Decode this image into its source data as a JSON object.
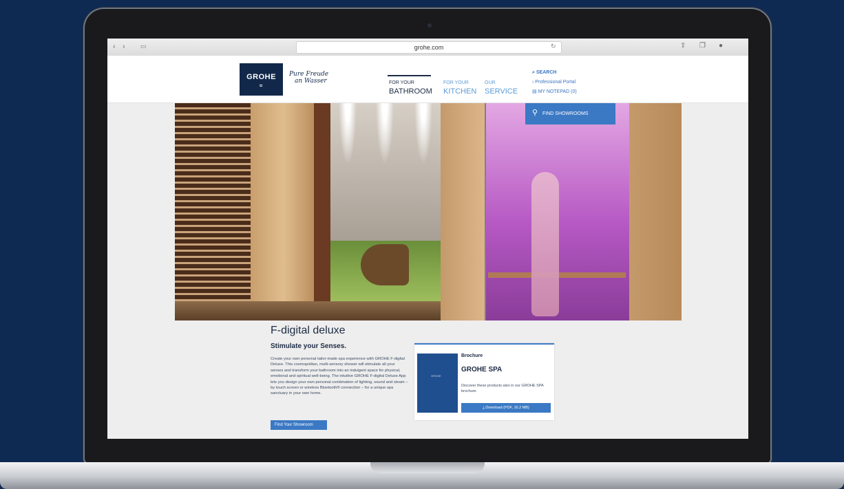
{
  "browser": {
    "url": "grohe.com",
    "icons": [
      "back-icon",
      "forward-icon",
      "sidebar-icon",
      "reload-icon",
      "share-icon",
      "tabs-icon",
      "extension-icon"
    ]
  },
  "header": {
    "logo_text": "GROHE",
    "tagline_line1": "Pure Freude",
    "tagline_line2": "an Wasser",
    "tabs": [
      {
        "small": "FOR YOUR",
        "big": "BATHROOM"
      },
      {
        "small": "FOR YOUR",
        "big": "KITCHEN"
      },
      {
        "small": "OUR",
        "big": "SERVICE"
      }
    ],
    "search": "SEARCH",
    "professional": "Professional Portal",
    "notepad": "MY NOTEPAD (0)",
    "showrooms": "FIND SHOWROOMS"
  },
  "content": {
    "title": "F-digital deluxe",
    "subtitle": "Stimulate your Senses.",
    "body": "Create your own personal tailor-made spa experience with GROHE F-digital Deluxe. This cosmopolitan, multi-sensory shower will stimulate all your senses and transform your bathroom into an indulgent space for physical, emotional and spiritual well-being. The intuitive GROHE F-digital Deluxe App lets you design your own personal combination of lighting, sound and steam – by touch screen or wireless Bluetooth® connection – for a unique spa sanctuary in your own home.",
    "cta": "Find Your Showroom"
  },
  "brochure": {
    "kicker": "Brochure",
    "title": "GROHE SPA",
    "desc": "Discover these products also in our GROHE SPA brochure",
    "download": "Download (PDF, 16.2 MB)"
  },
  "colors": {
    "accent": "#3b79c4",
    "navy": "#12284a",
    "background": "#0f2a52"
  }
}
